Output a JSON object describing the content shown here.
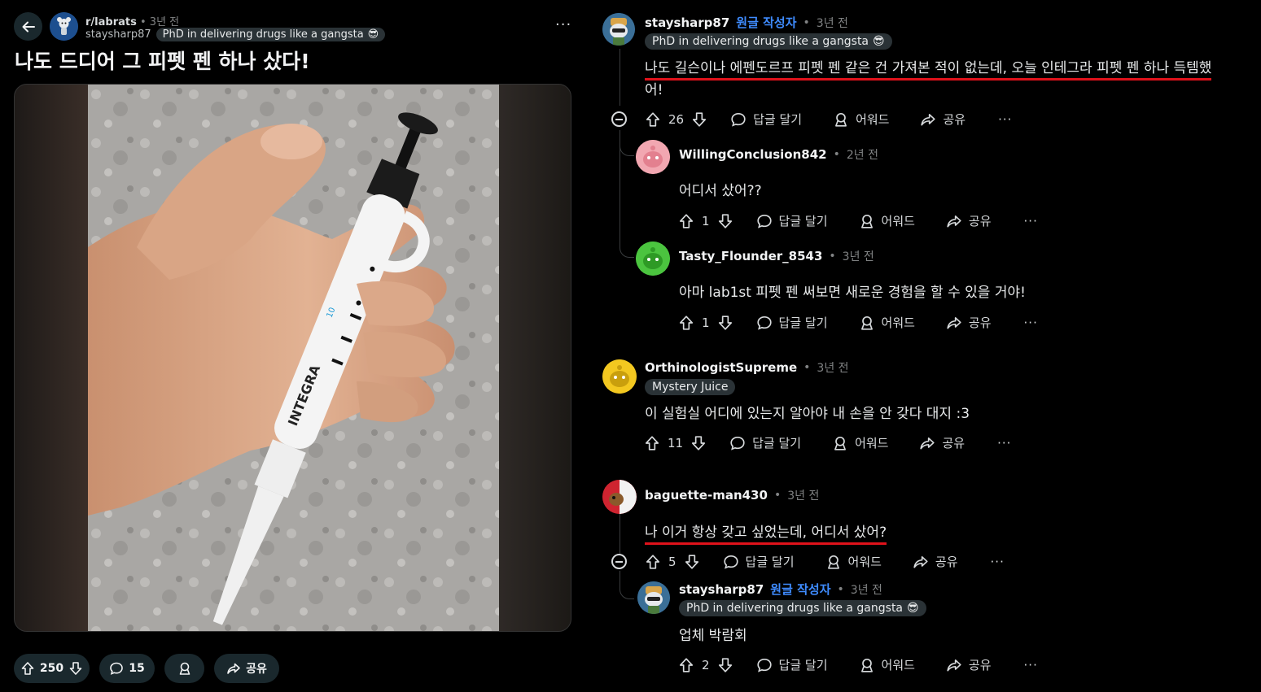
{
  "post": {
    "subreddit": "r/labrats",
    "time": "3년 전",
    "author": "staysharp87",
    "flair": "PhD in delivering drugs like a gangsta",
    "flair_emoji": "😎",
    "title": "나도 드디어 그 피펫 펜 하나 샀다!",
    "pen_brand": "INTEGRA",
    "pen_volume": "10",
    "more": "···",
    "upvotes": "250",
    "comments": "15",
    "share": "공유"
  },
  "comments": [
    {
      "user": "staysharp87",
      "op_label": "원글 작성자",
      "time": "3년 전",
      "flair": "PhD in delivering drugs like a gangsta",
      "flair_emoji": "😎",
      "text_line1": "나도 길슨이나 에펜도르프 피펫 펜 같은 건 가져본 적이 없는데, 오늘 인테그라 피펫 펜 하나 득템했",
      "text_line2": "어!",
      "score": "26"
    },
    {
      "user": "WillingConclusion842",
      "time": "2년 전",
      "text": "어디서 샀어??",
      "score": "1"
    },
    {
      "user": "Tasty_Flounder_8543",
      "time": "3년 전",
      "text": "아마 lab1st 피펫 펜 써보면 새로운 경험을 할 수 있을 거야!",
      "score": "1"
    },
    {
      "user": "OrthinologistSupreme",
      "time": "3년 전",
      "flair": "Mystery Juice",
      "text": "이 실험실 어디에 있는지 알아야 내 손을 안 갖다 대지 :3",
      "score": "11"
    },
    {
      "user": "baguette-man430",
      "time": "3년 전",
      "text": "나 이거 항상 갖고 싶었는데, 어디서 샀어?",
      "score": "5"
    },
    {
      "user": "staysharp87",
      "op_label": "원글 작성자",
      "time": "3년 전",
      "flair": "PhD in delivering drugs like a gangsta",
      "flair_emoji": "😎",
      "text": "업체 박람회",
      "score": "2"
    }
  ],
  "actions": {
    "reply": "답글 달기",
    "award": "어워드",
    "share": "공유",
    "more": "···"
  },
  "sep": "•",
  "colors": {
    "background": "#000000",
    "op_blue": "#3f8cff",
    "highlight_red": "#e0121b",
    "pill_bg": "#1a282d"
  }
}
